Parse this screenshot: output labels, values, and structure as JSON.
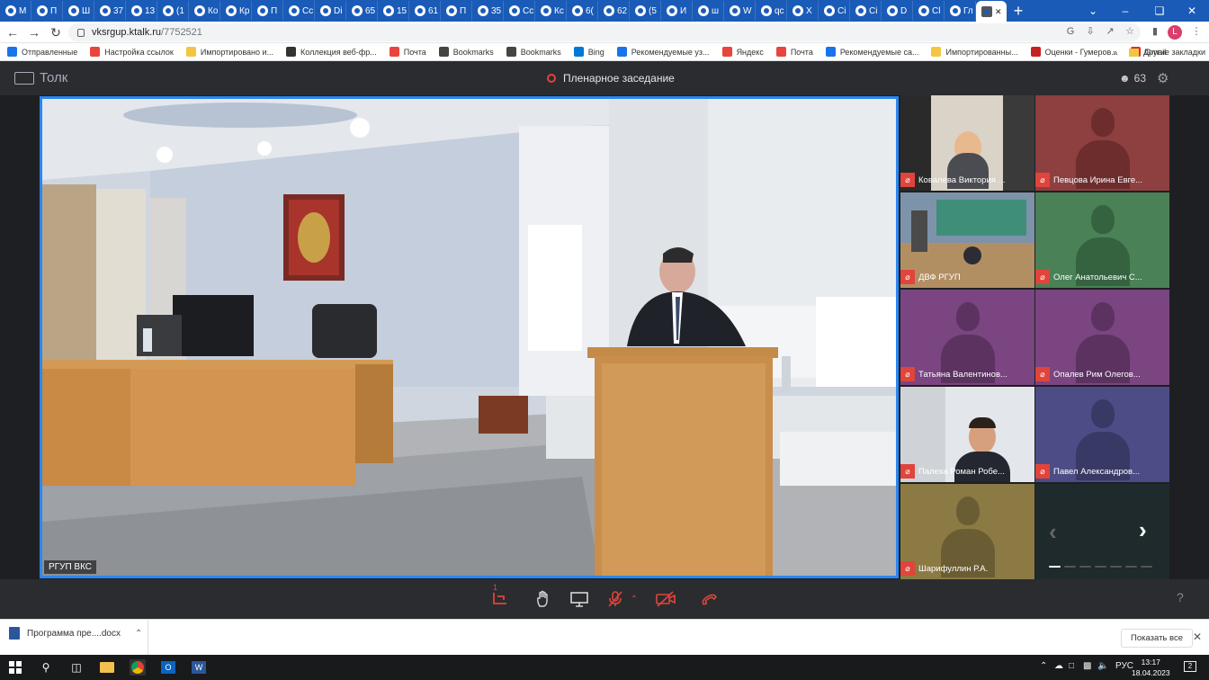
{
  "browser": {
    "tabs": [
      {
        "label": "М",
        "icon": "mail-icon"
      },
      {
        "label": "П",
        "icon": "mail-icon"
      },
      {
        "label": "Ш",
        "icon": "globe-icon"
      },
      {
        "label": "37",
        "icon": "globe-icon"
      },
      {
        "label": "13",
        "icon": "globe-icon"
      },
      {
        "label": "(1",
        "icon": "mail-icon"
      },
      {
        "label": "Ко",
        "icon": "globe-icon"
      },
      {
        "label": "Кр",
        "icon": "globe-icon"
      },
      {
        "label": "П",
        "icon": "globe-icon"
      },
      {
        "label": "Сс",
        "icon": "globe-icon"
      },
      {
        "label": "Di",
        "icon": "globe-icon"
      },
      {
        "label": "65",
        "icon": "globe-icon"
      },
      {
        "label": "15",
        "icon": "globe-icon"
      },
      {
        "label": "61",
        "icon": "globe-icon"
      },
      {
        "label": "П",
        "icon": "flag-icon"
      },
      {
        "label": "35",
        "icon": "globe-icon"
      },
      {
        "label": "Сс",
        "icon": "globe-icon"
      },
      {
        "label": "Кс",
        "icon": "globe-icon"
      },
      {
        "label": "6(",
        "icon": "globe-icon"
      },
      {
        "label": "62",
        "icon": "globe-icon"
      },
      {
        "label": "(5",
        "icon": "globe-icon"
      },
      {
        "label": "И",
        "icon": "globe-icon"
      },
      {
        "label": "ш",
        "icon": "google-icon"
      },
      {
        "label": "W",
        "icon": "globe-icon"
      },
      {
        "label": "qc",
        "icon": "google-icon"
      },
      {
        "label": "Х",
        "icon": "globe-icon"
      },
      {
        "label": "Сі",
        "icon": "globe-icon"
      },
      {
        "label": "Сі",
        "icon": "globe-icon"
      },
      {
        "label": "D",
        "icon": "google-icon"
      },
      {
        "label": "Cl",
        "icon": "google-icon"
      },
      {
        "label": "Гл",
        "icon": "flag-icon"
      }
    ],
    "active_tab_label": "",
    "address": {
      "host": "vksrgup.ktalk.ru",
      "path": "/7752521"
    },
    "bookmarks": [
      "Отправленные",
      "Настройка ссылок",
      "Импортировано и...",
      "Коллекция веб-фр...",
      "Почта",
      "Bookmarks",
      "Bookmarks",
      "Bing",
      "Рекомендуемые уз...",
      "Яндекс",
      "Почта",
      "Рекомендуемые са...",
      "Импортированны...",
      "Оценки - Гумеров...",
      "Gmail"
    ],
    "bookmarks_more": "Другие закладки",
    "profile_initial": "L"
  },
  "app": {
    "brand": "Толк",
    "meeting_title": "Пленарное заседание",
    "participants_count": "63",
    "main_video_label": "РГУП ВКС",
    "tiles": [
      {
        "name": "Ковалева Виктория ...",
        "type": "video",
        "bg": "#3a3a3a"
      },
      {
        "name": "Певцова Ирина Евге...",
        "type": "avatar",
        "bg": "#8e3f3f",
        "fg": "#6d2d2d"
      },
      {
        "name": "ДВФ РГУП",
        "type": "video",
        "bg": "#5a6d86"
      },
      {
        "name": "Олег Анатольевич С...",
        "type": "avatar",
        "bg": "#4a8157",
        "fg": "#35623f"
      },
      {
        "name": "Татьяна Валентинов...",
        "type": "avatar",
        "bg": "#7a4580",
        "fg": "#5c3261"
      },
      {
        "name": "Опалев Рим Олегов...",
        "type": "avatar",
        "bg": "#7a4580",
        "fg": "#5c3261"
      },
      {
        "name": "Палеха Роман Робе...",
        "type": "video",
        "bg": "#c9cdd2"
      },
      {
        "name": "Павел Александров...",
        "type": "avatar",
        "bg": "#4c4d86",
        "fg": "#383965"
      },
      {
        "name": "Шарифуллин Р.А.",
        "type": "avatar",
        "bg": "#8c7a45",
        "fg": "#6b5d33"
      }
    ],
    "controls": [
      "share-screen-icon",
      "raise-hand-icon",
      "screen-icon",
      "mic-off-icon",
      "camera-off-icon",
      "hangup-icon"
    ],
    "share_badge": "1",
    "help": "?"
  },
  "downloads": {
    "file": "Программа пре....docx",
    "show_all": "Показать все"
  },
  "taskbar": {
    "lang": "РУС",
    "time": "13:17",
    "date": "18.04.2023",
    "notifications": "2"
  },
  "colors": {
    "accent": "#2a86f0",
    "danger": "#e0443b",
    "app_bg": "#1e1f22",
    "header_bg": "#2b2c30"
  }
}
